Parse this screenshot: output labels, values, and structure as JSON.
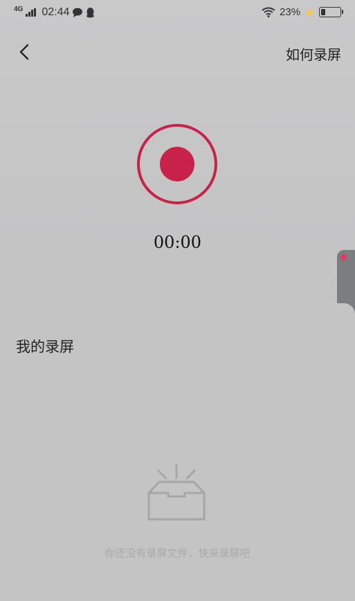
{
  "status_bar": {
    "network": "4G",
    "time": "02:44",
    "battery_percent": "23%",
    "battery_level": 0.23,
    "left_icons": [
      "signal-icon",
      "chat-bubble-icon",
      "penguin-icon"
    ],
    "right_icons": [
      "wifi-icon",
      "charging-icon",
      "battery-icon"
    ]
  },
  "topbar": {
    "back_icon": "chevron-left-icon",
    "howto_label": "如何录屏"
  },
  "recorder": {
    "timer": "00:00",
    "accent_color": "#c8214a"
  },
  "panel": {
    "title": "我的录屏",
    "empty_icon": "open-box-icon",
    "empty_text": "你还没有录屏文件，快来录屏吧"
  }
}
